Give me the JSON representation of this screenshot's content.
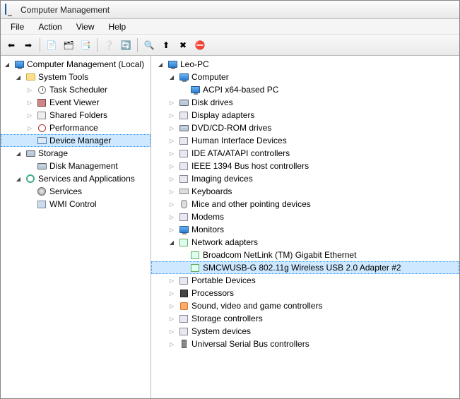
{
  "window": {
    "title": "Computer Management"
  },
  "menu": {
    "file": "File",
    "action": "Action",
    "view": "View",
    "help": "Help"
  },
  "toolbar_icons": [
    "back",
    "forward",
    "up",
    "show-hide-tree",
    "properties",
    "delete",
    "refresh",
    "export",
    "help",
    "scan-hardware",
    "update-driver",
    "uninstall",
    "disable"
  ],
  "left_tree": [
    {
      "d": 0,
      "exp": "open",
      "icon": "monitor",
      "label": "Computer Management (Local)",
      "name": "root-computer-management"
    },
    {
      "d": 1,
      "exp": "open",
      "icon": "folder",
      "label": "System Tools",
      "name": "node-system-tools"
    },
    {
      "d": 2,
      "exp": "closed",
      "icon": "clock",
      "label": "Task Scheduler",
      "name": "node-task-scheduler"
    },
    {
      "d": 2,
      "exp": "closed",
      "icon": "book",
      "label": "Event Viewer",
      "name": "node-event-viewer"
    },
    {
      "d": 2,
      "exp": "closed",
      "icon": "share",
      "label": "Shared Folders",
      "name": "node-shared-folders"
    },
    {
      "d": 2,
      "exp": "closed",
      "icon": "perf",
      "label": "Performance",
      "name": "node-performance"
    },
    {
      "d": 2,
      "exp": "none",
      "icon": "devmgr",
      "label": "Device Manager",
      "name": "node-device-manager",
      "sel": true
    },
    {
      "d": 1,
      "exp": "open",
      "icon": "disk",
      "label": "Storage",
      "name": "node-storage"
    },
    {
      "d": 2,
      "exp": "none",
      "icon": "disk",
      "label": "Disk Management",
      "name": "node-disk-management"
    },
    {
      "d": 1,
      "exp": "open",
      "icon": "gear",
      "label": "Services and Applications",
      "name": "node-services-apps"
    },
    {
      "d": 2,
      "exp": "none",
      "icon": "svc",
      "label": "Services",
      "name": "node-services"
    },
    {
      "d": 2,
      "exp": "none",
      "icon": "wmi",
      "label": "WMI Control",
      "name": "node-wmi-control"
    }
  ],
  "right_tree": [
    {
      "d": 0,
      "exp": "open",
      "icon": "monitor",
      "label": "Leo-PC",
      "name": "dev-root"
    },
    {
      "d": 1,
      "exp": "open",
      "icon": "monitor",
      "label": "Computer",
      "name": "dev-computer"
    },
    {
      "d": 2,
      "exp": "none",
      "icon": "monitor",
      "label": "ACPI x64-based PC",
      "name": "dev-acpi"
    },
    {
      "d": 1,
      "exp": "closed",
      "icon": "disk",
      "label": "Disk drives",
      "name": "dev-disk-drives"
    },
    {
      "d": 1,
      "exp": "closed",
      "icon": "dev",
      "label": "Display adapters",
      "name": "dev-display"
    },
    {
      "d": 1,
      "exp": "closed",
      "icon": "disk",
      "label": "DVD/CD-ROM drives",
      "name": "dev-dvd"
    },
    {
      "d": 1,
      "exp": "closed",
      "icon": "dev",
      "label": "Human Interface Devices",
      "name": "dev-hid"
    },
    {
      "d": 1,
      "exp": "closed",
      "icon": "dev",
      "label": "IDE ATA/ATAPI controllers",
      "name": "dev-ide"
    },
    {
      "d": 1,
      "exp": "closed",
      "icon": "dev",
      "label": "IEEE 1394 Bus host controllers",
      "name": "dev-1394"
    },
    {
      "d": 1,
      "exp": "closed",
      "icon": "dev",
      "label": "Imaging devices",
      "name": "dev-imaging"
    },
    {
      "d": 1,
      "exp": "closed",
      "icon": "kb",
      "label": "Keyboards",
      "name": "dev-keyboards"
    },
    {
      "d": 1,
      "exp": "closed",
      "icon": "mouse",
      "label": "Mice and other pointing devices",
      "name": "dev-mice"
    },
    {
      "d": 1,
      "exp": "closed",
      "icon": "dev",
      "label": "Modems",
      "name": "dev-modems"
    },
    {
      "d": 1,
      "exp": "closed",
      "icon": "monitor",
      "label": "Monitors",
      "name": "dev-monitors"
    },
    {
      "d": 1,
      "exp": "open",
      "icon": "net",
      "label": "Network adapters",
      "name": "dev-network-adapters"
    },
    {
      "d": 2,
      "exp": "none",
      "icon": "net",
      "label": "Broadcom NetLink (TM) Gigabit Ethernet",
      "name": "dev-broadcom"
    },
    {
      "d": 2,
      "exp": "none",
      "icon": "net",
      "label": "SMCWUSB-G 802.11g Wireless USB 2.0 Adapter #2",
      "name": "dev-smcwusb",
      "sel": true
    },
    {
      "d": 1,
      "exp": "closed",
      "icon": "dev",
      "label": "Portable Devices",
      "name": "dev-portable"
    },
    {
      "d": 1,
      "exp": "closed",
      "icon": "cpu",
      "label": "Processors",
      "name": "dev-processors"
    },
    {
      "d": 1,
      "exp": "closed",
      "icon": "snd",
      "label": "Sound, video and game controllers",
      "name": "dev-sound"
    },
    {
      "d": 1,
      "exp": "closed",
      "icon": "dev",
      "label": "Storage controllers",
      "name": "dev-storage-ctrl"
    },
    {
      "d": 1,
      "exp": "closed",
      "icon": "dev",
      "label": "System devices",
      "name": "dev-system"
    },
    {
      "d": 1,
      "exp": "closed",
      "icon": "usb",
      "label": "Universal Serial Bus controllers",
      "name": "dev-usb"
    }
  ]
}
